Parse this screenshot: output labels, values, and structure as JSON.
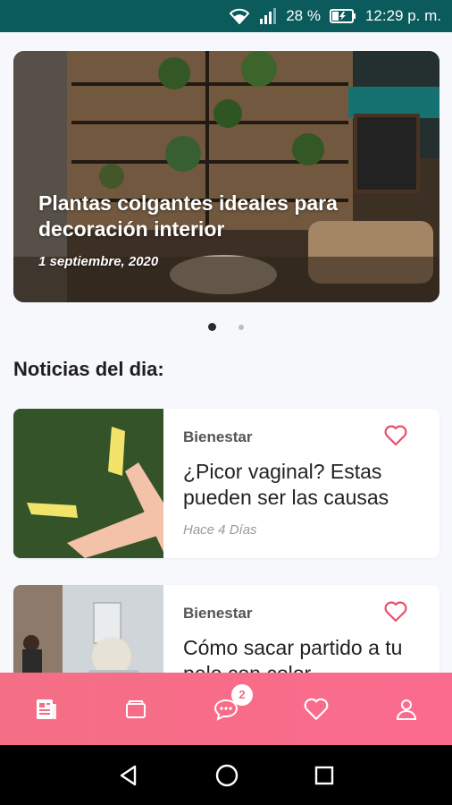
{
  "status_bar": {
    "battery_percent": "28 %",
    "time": "12:29 p. m.",
    "icons": [
      "wifi-icon",
      "signal-icon",
      "battery-icon"
    ]
  },
  "hero": {
    "title": "Plantas colgantes ideales para decoración interior",
    "date": "1 septiembre, 2020",
    "pager": {
      "active_index": 0,
      "count": 2
    }
  },
  "section": {
    "title": "Noticias del dia:"
  },
  "news": [
    {
      "category": "Bienestar",
      "headline": "¿Picor vaginal? Estas pueden ser las causas",
      "time_ago": "Hace 4 Días"
    },
    {
      "category": "Bienestar",
      "headline": "Cómo sacar partido a tu pelo con color"
    }
  ],
  "bottom_nav": {
    "items": [
      "news-icon",
      "wallet-icon",
      "chat-icon",
      "heart-icon",
      "profile-icon"
    ],
    "chat_badge": "2"
  },
  "colors": {
    "status_bar": "#0b5a5c",
    "accent": "#f46e85",
    "heart": "#e94f6a"
  }
}
